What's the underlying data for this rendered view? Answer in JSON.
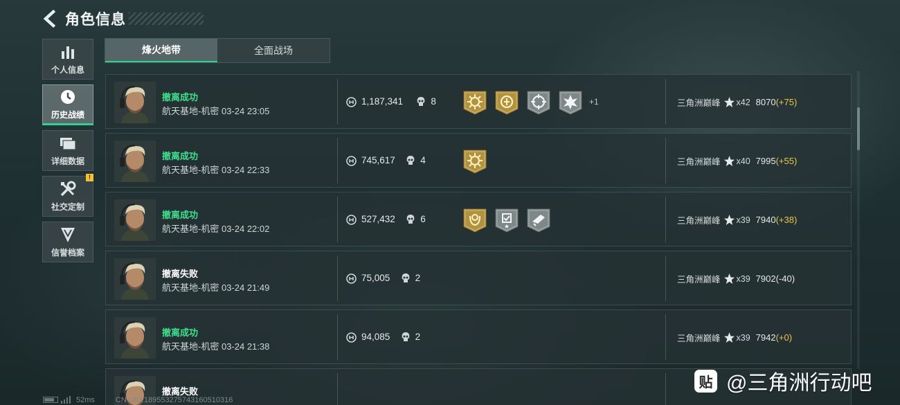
{
  "header": {
    "title": "角色信息",
    "back_icon": "back-arrow-icon"
  },
  "sidebar": {
    "items": [
      {
        "label": "个人信息",
        "icon": "bar-chart-icon",
        "active": false
      },
      {
        "label": "历史战绩",
        "icon": "clock-history-icon",
        "active": true
      },
      {
        "label": "详细数据",
        "icon": "folder-stack-icon",
        "active": false
      },
      {
        "label": "社交定制",
        "icon": "tools-icon",
        "active": false,
        "badge": "!"
      },
      {
        "label": "信誉档案",
        "icon": "shield-chevron-icon",
        "active": false
      }
    ]
  },
  "tabs": [
    {
      "label": "烽火地带",
      "active": true
    },
    {
      "label": "全面战场",
      "active": false
    }
  ],
  "matches": [
    {
      "status": "撤离成功",
      "result": "ok",
      "map": "航天基地-机密",
      "time": "03-24 23:05",
      "value": "1,187,341",
      "kills": "8",
      "badges": [
        "gold-sun-medal-icon",
        "gold-crest-medal-icon",
        "silver-crosshair-medal-icon",
        "silver-burst-medal-icon"
      ],
      "more": "+1",
      "rank_label": "三角洲巅峰",
      "stars": "x42",
      "score": "8070",
      "delta": "(+75)"
    },
    {
      "status": "撤离成功",
      "result": "ok",
      "map": "航天基地-机密",
      "time": "03-24 22:33",
      "value": "745,617",
      "kills": "4",
      "badges": [
        "gold-sun-medal-icon"
      ],
      "more": "",
      "rank_label": "三角洲巅峰",
      "stars": "x40",
      "score": "7995",
      "delta": "(+55)"
    },
    {
      "status": "撤离成功",
      "result": "ok",
      "map": "航天基地-机密",
      "time": "03-24 22:02",
      "value": "527,432",
      "kills": "6",
      "badges": [
        "gold-laurel-medal-icon",
        "silver-shield-medal-icon",
        "silver-gun-medal-icon"
      ],
      "more": "",
      "rank_label": "三角洲巅峰",
      "stars": "x39",
      "score": "7940",
      "delta": "(+38)"
    },
    {
      "status": "撤离失败",
      "result": "fail",
      "map": "航天基地-机密",
      "time": "03-24 21:49",
      "value": "75,005",
      "kills": "2",
      "badges": [],
      "more": "",
      "rank_label": "三角洲巅峰",
      "stars": "x39",
      "score": "7902",
      "delta": "(-40)"
    },
    {
      "status": "撤离成功",
      "result": "ok",
      "map": "航天基地-机密",
      "time": "03-24 21:38",
      "value": "94,085",
      "kills": "2",
      "badges": [],
      "more": "",
      "rank_label": "三角洲巅峰",
      "stars": "x39",
      "score": "7942",
      "delta": "(+0)"
    },
    {
      "status": "撤离失败",
      "result": "fail",
      "map": "",
      "time": "",
      "value": "",
      "kills": "",
      "badges": [],
      "more": "",
      "rank_label": "",
      "stars": "",
      "score": "",
      "delta": ""
    }
  ],
  "footer": {
    "ping": "52ms",
    "uid": "CN UID:189553275743160510316"
  },
  "watermark": {
    "logo": "贴",
    "text": "@三角洲行动吧"
  },
  "colors": {
    "success": "#3ee08e",
    "accent": "#33d090",
    "gain": "#e7c74a",
    "loss": "#e6eaea"
  }
}
